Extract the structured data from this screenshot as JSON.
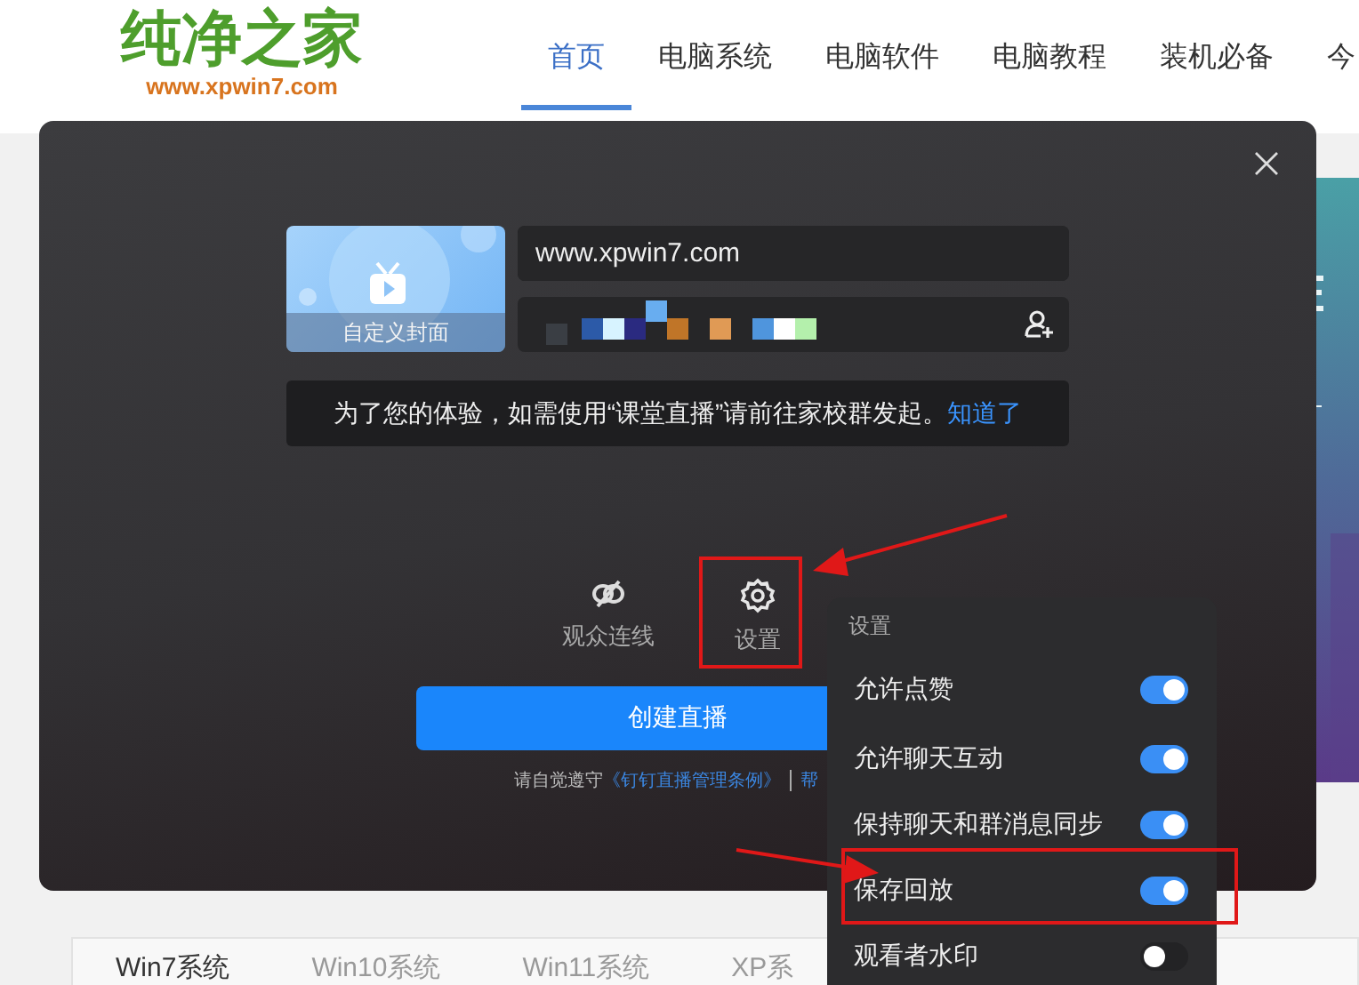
{
  "header": {
    "logo": {
      "title": "纯净之家",
      "url": "www.xpwin7.com"
    },
    "nav": [
      {
        "label": "首页",
        "selected": true
      },
      {
        "label": "电脑系统",
        "selected": false
      },
      {
        "label": "电脑软件",
        "selected": false
      },
      {
        "label": "电脑教程",
        "selected": false
      },
      {
        "label": "装机必备",
        "selected": false
      },
      {
        "label": "今",
        "selected": false
      }
    ]
  },
  "dialog": {
    "cover": {
      "label": "自定义封面"
    },
    "title_field": {
      "value": "www.xpwin7.com"
    },
    "notice": {
      "text": "为了您的体验，如需使用“课堂直播”请前往家校群发起。",
      "link": "知道了"
    },
    "actions": [
      {
        "label": "观众连线",
        "kind": "link-off"
      },
      {
        "label": "设置",
        "kind": "gear"
      }
    ],
    "create_button": "创建直播",
    "footer": {
      "prefix": "请自觉遵守",
      "link": "《钉钉直播管理条例》",
      "help_link": "帮"
    }
  },
  "settings_menu": {
    "title": "设置",
    "items": [
      {
        "label": "允许点赞",
        "on": true
      },
      {
        "label": "允许聊天互动",
        "on": true
      },
      {
        "label": "保持聊天和群消息同步",
        "on": true
      },
      {
        "label": "保存回放",
        "on": true
      },
      {
        "label": "观看者水印",
        "on": false
      }
    ]
  },
  "page_tabs": [
    {
      "label": "Win7系统",
      "selected": true
    },
    {
      "label": "Win10系统",
      "selected": false
    },
    {
      "label": "Win11系统",
      "selected": false
    },
    {
      "label": "XP系",
      "selected": false
    }
  ]
}
